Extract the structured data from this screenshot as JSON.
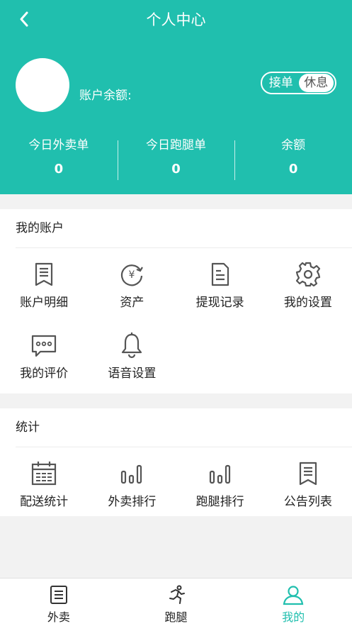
{
  "header": {
    "title": "个人中心",
    "balance_label": "账户余额:",
    "toggle_on": "接单",
    "toggle_off": "休息",
    "bg_color": "#20bfae"
  },
  "stats": [
    {
      "label": "今日外卖单",
      "value": "0"
    },
    {
      "label": "今日跑腿单",
      "value": "0"
    },
    {
      "label": "余额",
      "value": "0"
    }
  ],
  "account": {
    "title": "我的账户",
    "items": [
      {
        "label": "账户明细",
        "icon": "ledger-icon"
      },
      {
        "label": "资产",
        "icon": "yuan-refresh-icon"
      },
      {
        "label": "提现记录",
        "icon": "document-icon"
      },
      {
        "label": "我的设置",
        "icon": "gear-icon"
      },
      {
        "label": "我的评价",
        "icon": "chat-bubble-icon"
      },
      {
        "label": "语音设置",
        "icon": "bell-icon"
      }
    ]
  },
  "statistics": {
    "title": "统计",
    "items": [
      {
        "label": "配送统计",
        "icon": "calendar-icon"
      },
      {
        "label": "外卖排行",
        "icon": "bar-chart-icon"
      },
      {
        "label": "跑腿排行",
        "icon": "bar-chart-icon"
      },
      {
        "label": "公告列表",
        "icon": "bookmark-list-icon"
      }
    ]
  },
  "tabbar": {
    "items": [
      {
        "label": "外卖",
        "icon": "list-icon"
      },
      {
        "label": "跑腿",
        "icon": "runner-icon"
      },
      {
        "label": "我的",
        "icon": "user-icon"
      }
    ],
    "active": "我的",
    "active_color": "#20bfae"
  }
}
